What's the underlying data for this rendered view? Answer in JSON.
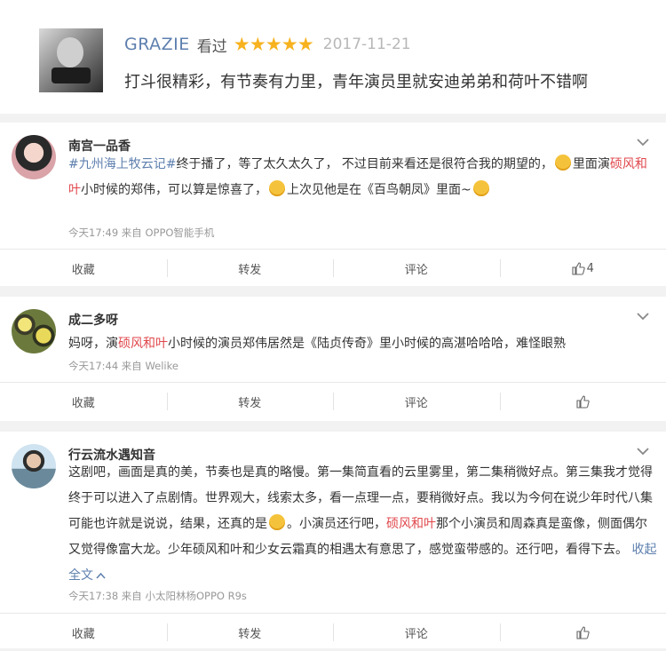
{
  "top_review": {
    "username": "GRAZIE",
    "watched": "看过",
    "rating": 5,
    "date": "2017-11-21",
    "text": "打斗很精彩，有节奏有力里，青年演员里就安迪弟弟和荷叶不错啊"
  },
  "comments": [
    {
      "username": "南宫一品香",
      "tag": "#九州海上牧云记#",
      "p1": "终于播了，等了太久太久了， 不过目前来看还是很符合我的期望的，",
      "p2": "里面演",
      "hl1": "硕风和叶",
      "p3": "小时候的郑伟，可以算是惊喜了，",
      "p4": "上次见他是在《百鸟朝凤》里面~",
      "time": "今天17:49 来自 OPPO智能手机",
      "actions": [
        "收藏",
        "转发",
        "评论",
        "4"
      ]
    },
    {
      "username": "成二多呀",
      "p1": "妈呀，演",
      "hl1": "硕风和叶",
      "p2": "小时候的演员郑伟居然是《陆贞传奇》里小时候的高湛哈哈哈，难怪眼熟",
      "time": "今天17:44 来自 Welike",
      "actions": [
        "收藏",
        "转发",
        "评论",
        ""
      ]
    },
    {
      "username": "行云流水遇知音",
      "p1": "这剧吧，画面是真的美，节奏也是真的略慢。第一集简直看的云里雾里，第二集稍微好点。第三集我才觉得终于可以进入了点剧情。世界观大，线索太多，看一点理一点，要稍微好点。我以为今何在说少年时代八集可能也许就是说说，结果，还真的是",
      "p2": "。小演员还行吧，",
      "hl1": "硕风和叶",
      "p3": "那个小演员和周森真是蛮像，侧面偶尔又觉得像富大龙。少年硕风和叶和少女云霜真的相遇太有意思了，感觉蛮带感的。还行吧，看得下去。",
      "collapse": "收起全文",
      "time": "今天17:38 来自 小太阳林杨OPPO R9s",
      "actions": [
        "收藏",
        "转发",
        "评论",
        ""
      ]
    }
  ]
}
